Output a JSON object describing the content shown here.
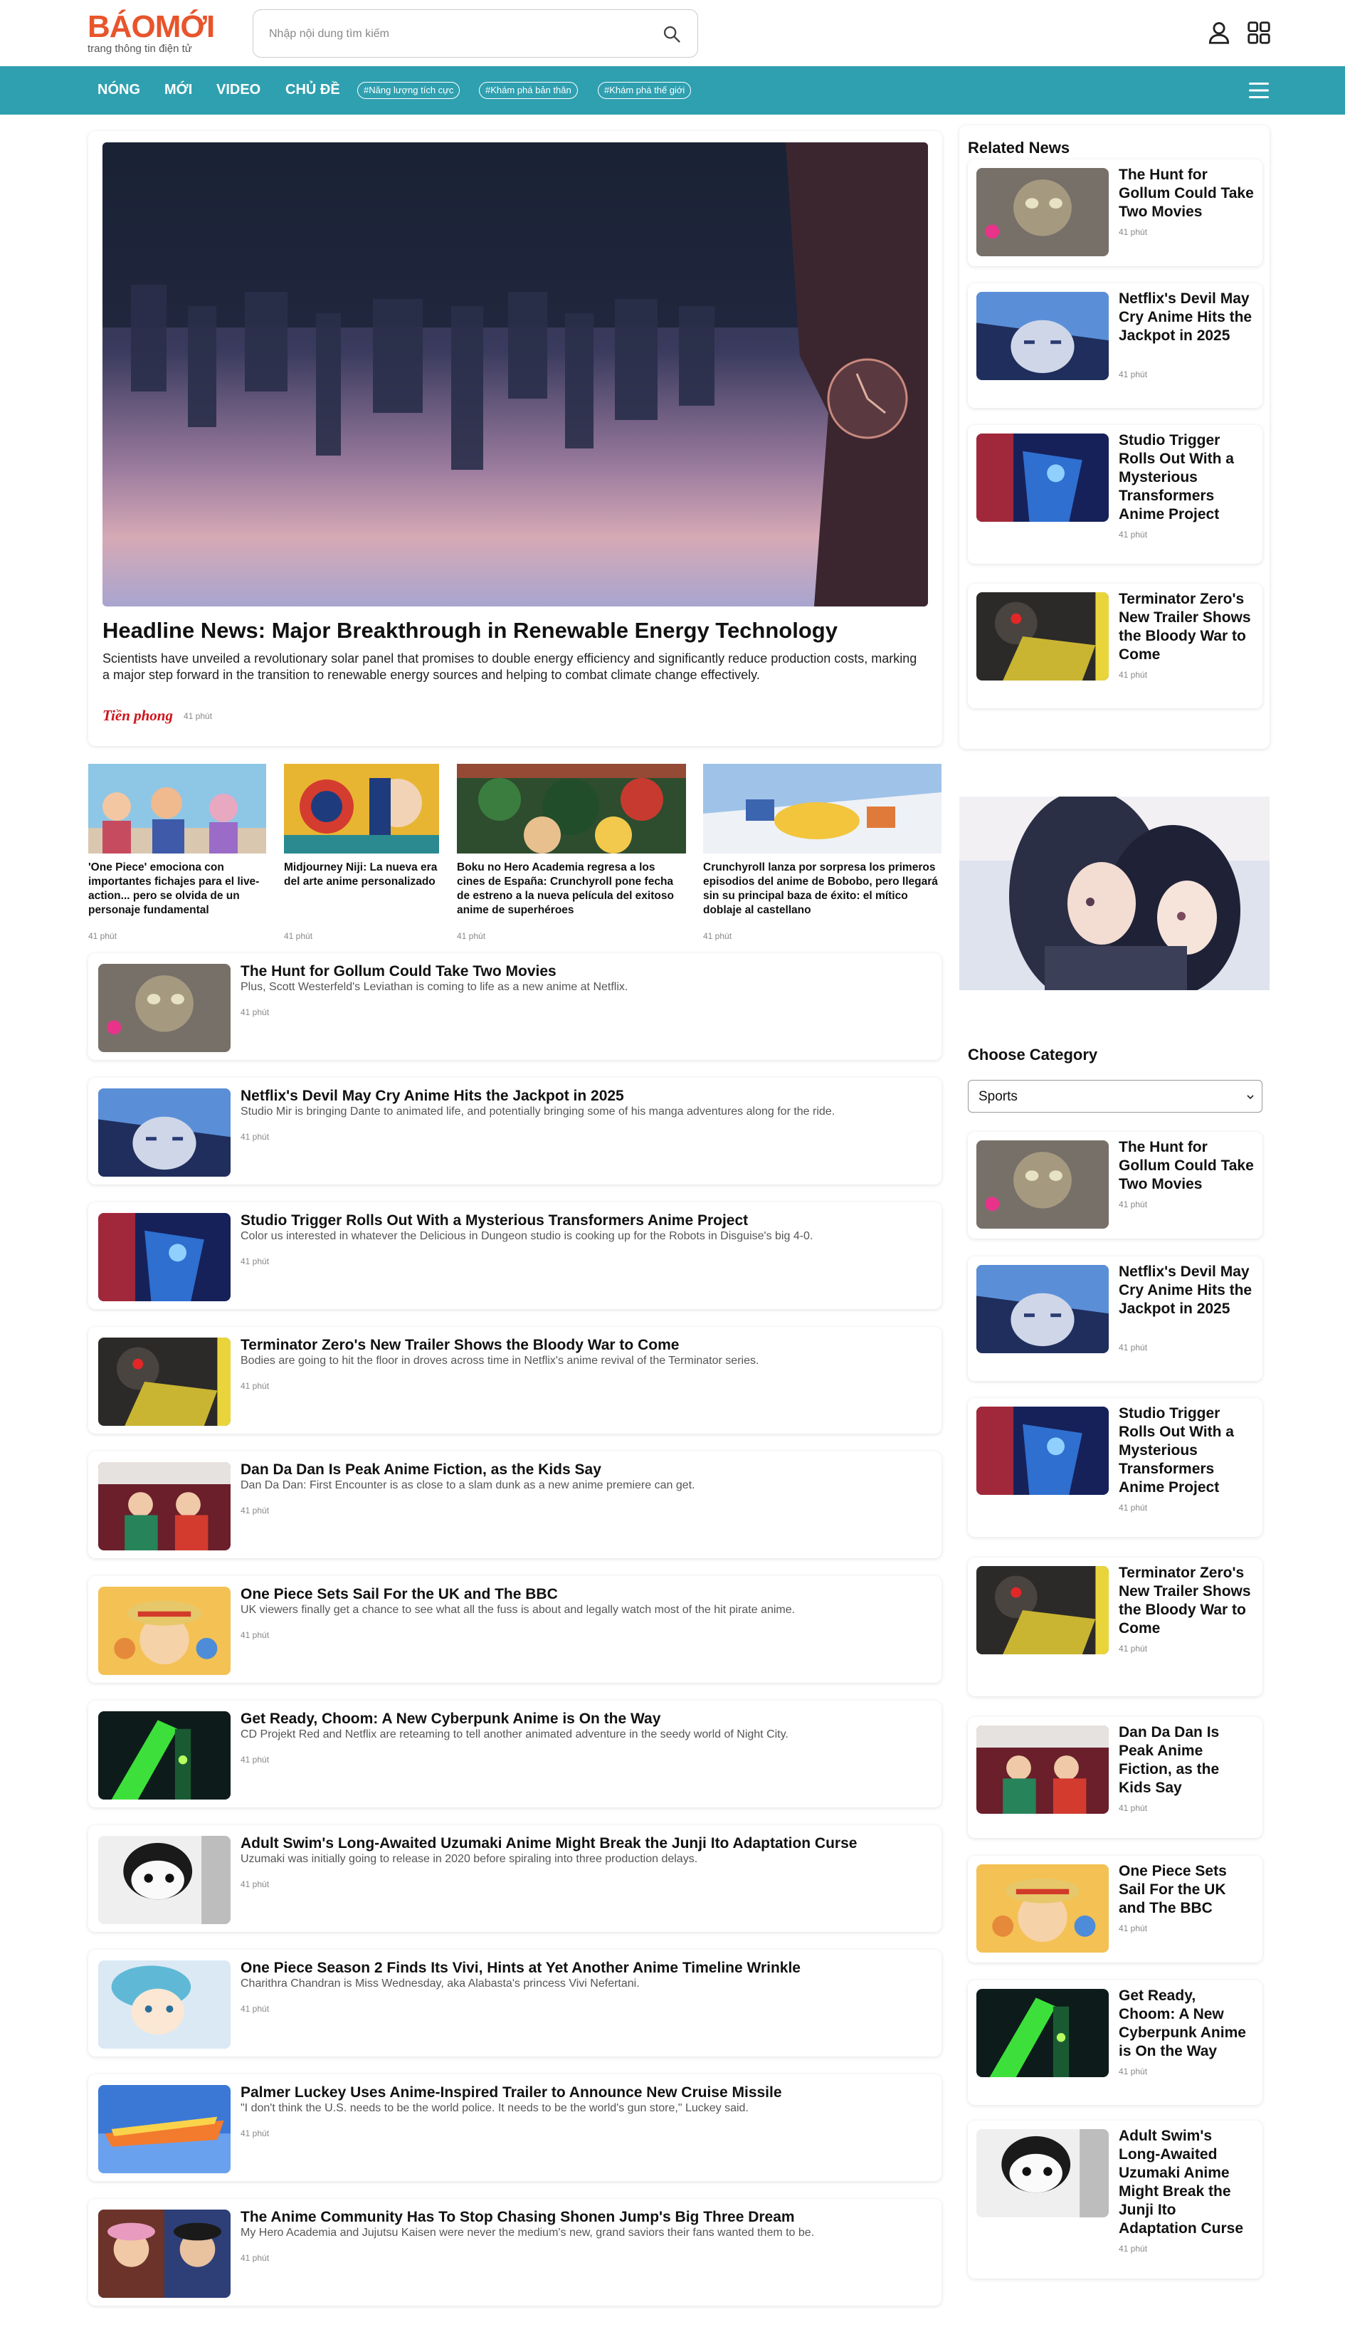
{
  "header": {
    "logo": "BÁOMỚI",
    "logo_sub": "trang thông tin điện tử",
    "search_placeholder": "Nhập nội dung tìm kiếm"
  },
  "nav": {
    "items": [
      "NÓNG",
      "MỚI",
      "VIDEO",
      "CHỦ ĐỀ"
    ],
    "tags": [
      "#Năng lượng tích cực",
      "#Khám phá bản thân",
      "#Khám phá thế giới"
    ]
  },
  "hero": {
    "title": "Headline News: Major Breakthrough in Renewable Energy Technology",
    "description": "Scientists have unveiled a revolutionary solar panel that promises to double energy efficiency and significantly reduce production costs, marking a major step forward in the transition to renewable energy sources and helping to combat climate change effectively.",
    "source": "Tiền phong",
    "time": "41 phút"
  },
  "mini_articles": [
    {
      "title": "'One Piece' emociona con importantes fichajes para el live-action... pero se olvida de un personaje fundamental",
      "time": "41 phút"
    },
    {
      "title": "Midjourney Niji: La nueva era del arte anime personalizado",
      "time": "41 phút"
    },
    {
      "title": "Boku no Hero Academia regresa a los cines de España: Crunchyroll pone fecha de estreno a la nueva película del exitoso anime de superhéroes",
      "time": "41 phút"
    },
    {
      "title": "Crunchyroll lanza por sorpresa los primeros episodios del anime de Bobobo, pero llegará sin su principal baza de éxito: el mítico doblaje al castellano",
      "time": "41 phút"
    }
  ],
  "list_articles": [
    {
      "title": "The Hunt for Gollum Could Take Two Movies",
      "desc": "Plus, Scott Westerfeld's Leviathan is coming to life as a new anime at Netflix.",
      "time": "41 phút"
    },
    {
      "title": "Netflix's Devil May Cry Anime Hits the Jackpot in 2025",
      "desc": "Studio Mir is bringing Dante to animated life, and potentially bringing some of his manga adventures along for the ride.",
      "time": "41 phút"
    },
    {
      "title": "Studio Trigger Rolls Out With a Mysterious Transformers Anime Project",
      "desc": "Color us interested in whatever the Delicious in Dungeon studio is cooking up for the Robots in Disguise's big 4-0.",
      "time": "41 phút"
    },
    {
      "title": "Terminator Zero's New Trailer Shows the Bloody War to Come",
      "desc": "Bodies are going to hit the floor in droves across time in Netflix's anime revival of the Terminator series.",
      "time": "41 phút"
    },
    {
      "title": "Dan Da Dan Is Peak Anime Fiction, as the Kids Say",
      "desc": "Dan Da Dan: First Encounter is as close to a slam dunk as a new anime premiere can get.",
      "time": "41 phút"
    },
    {
      "title": "One Piece Sets Sail For the UK and The BBC",
      "desc": "UK viewers finally get a chance to see what all the fuss is about and legally watch most of the hit pirate anime.",
      "time": "41 phút"
    },
    {
      "title": "Get Ready, Choom: A New Cyberpunk Anime is On the Way",
      "desc": "CD Projekt Red and Netflix are reteaming to tell another animated adventure in the seedy world of Night City.",
      "time": "41 phút"
    },
    {
      "title": "Adult Swim's Long-Awaited Uzumaki Anime Might Break the Junji Ito Adaptation Curse",
      "desc": "Uzumaki was initially going to release in 2020 before spiraling into three production delays.",
      "time": "41 phút"
    },
    {
      "title": "One Piece Season 2 Finds Its Vivi, Hints at Yet Another Anime Timeline Wrinkle",
      "desc": "Charithra Chandran is Miss Wednesday, aka Alabasta's princess Vivi Nefertani.",
      "time": "41 phút"
    },
    {
      "title": "Palmer Luckey Uses Anime-Inspired Trailer to Announce New Cruise Missile",
      "desc": "\"I don't think the U.S. needs to be the world police. It needs to be the world's gun store,\" Luckey said.",
      "time": "41 phút"
    },
    {
      "title": "The Anime Community Has To Stop Chasing Shonen Jump's Big Three Dream",
      "desc": "My Hero Academia and Jujutsu Kaisen were never the medium's new, grand saviors their fans wanted them to be.",
      "time": "41 phút"
    }
  ],
  "related": {
    "heading": "Related News",
    "items": [
      {
        "title": "The Hunt for Gollum Could Take Two Movies",
        "time": "41 phút"
      },
      {
        "title": "Netflix's Devil May Cry Anime Hits the Jackpot in 2025",
        "time": "41 phút"
      },
      {
        "title": "Studio Trigger Rolls Out With a Mysterious Transformers Anime Project",
        "time": "41 phút"
      },
      {
        "title": "Terminator Zero's New Trailer Shows the Bloody War to Come",
        "time": "41 phút"
      }
    ]
  },
  "category": {
    "heading": "Choose Category",
    "selected": "Sports",
    "items": [
      {
        "title": "The Hunt for Gollum Could Take Two Movies",
        "time": "41 phút"
      },
      {
        "title": "Netflix's Devil May Cry Anime Hits the Jackpot in 2025",
        "time": "41 phút"
      },
      {
        "title": "Studio Trigger Rolls Out With a Mysterious Transformers Anime Project",
        "time": "41 phút"
      },
      {
        "title": "Terminator Zero's New Trailer Shows the Bloody War to Come",
        "time": "41 phút"
      },
      {
        "title": "Dan Da Dan Is Peak Anime Fiction, as the Kids Say",
        "time": "41 phút"
      },
      {
        "title": "One Piece Sets Sail For the UK and The BBC",
        "time": "41 phút"
      },
      {
        "title": "Get Ready, Choom: A New Cyberpunk Anime is On the Way",
        "time": "41 phút"
      },
      {
        "title": "Adult Swim's Long-Awaited Uzumaki Anime Might Break the Junji Ito Adaptation Curse",
        "time": "41 phút"
      }
    ]
  },
  "colors": {
    "brand": "#e8542b",
    "nav": "#2fa0b0"
  }
}
